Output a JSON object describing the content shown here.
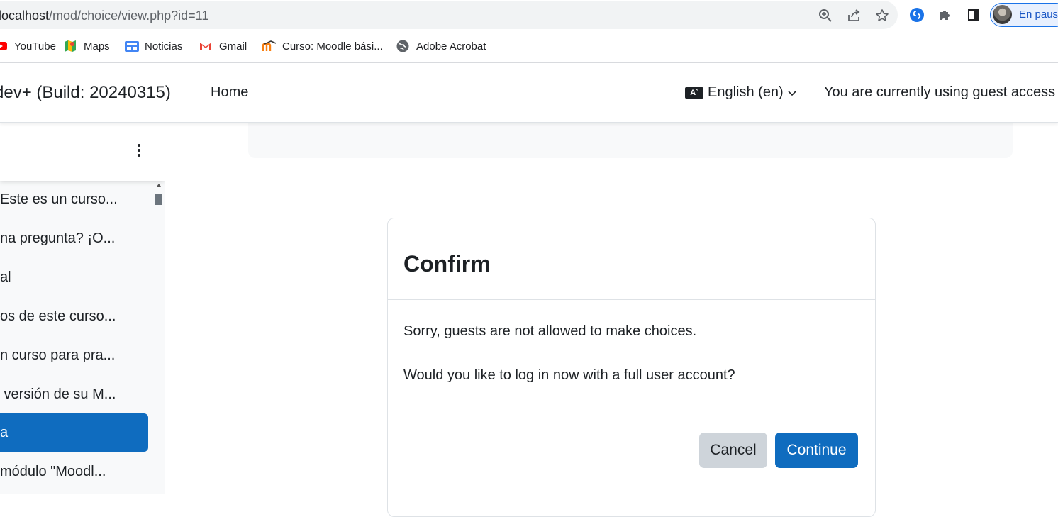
{
  "browser": {
    "url_host": "localhost",
    "url_path": "/mod/choice/view.php?id=11",
    "profile_label": "En pausa",
    "bookmarks": [
      {
        "label": "YouTube",
        "icon": "youtube-icon"
      },
      {
        "label": "Maps",
        "icon": "maps-icon"
      },
      {
        "label": "Noticias",
        "icon": "news-icon"
      },
      {
        "label": "Gmail",
        "icon": "gmail-icon"
      },
      {
        "label": "Curso: Moodle bási...",
        "icon": "moodle-icon"
      },
      {
        "label": "Adobe Acrobat",
        "icon": "globe-icon"
      }
    ]
  },
  "navbar": {
    "site_name": "dev+ (Build: 20240315)",
    "home": "Home",
    "language": "English (en)",
    "language_icon_text": "A`",
    "guest_notice": "You are currently using guest access"
  },
  "drawer": {
    "items": [
      {
        "label": "Este es un curso...",
        "active": false
      },
      {
        "label": "na pregunta? ¡O...",
        "active": false
      },
      {
        "label": "al",
        "active": false
      },
      {
        "label": "os de este curso...",
        "active": false
      },
      {
        "label": "n curso para pra...",
        "active": false
      },
      {
        "label": " versión de su M...",
        "active": false
      },
      {
        "label": "a",
        "active": true
      },
      {
        "label": "módulo \"Moodl...",
        "active": false
      }
    ]
  },
  "modal": {
    "title": "Confirm",
    "message_1": "Sorry, guests are not allowed to make choices.",
    "message_2": "Would you like to log in now with a full user account?",
    "cancel_label": "Cancel",
    "continue_label": "Continue"
  },
  "colors": {
    "primary": "#0f6cbf",
    "secondary": "#ced4da",
    "text": "#1d2125",
    "drawer_bg": "#f8f9fa"
  }
}
